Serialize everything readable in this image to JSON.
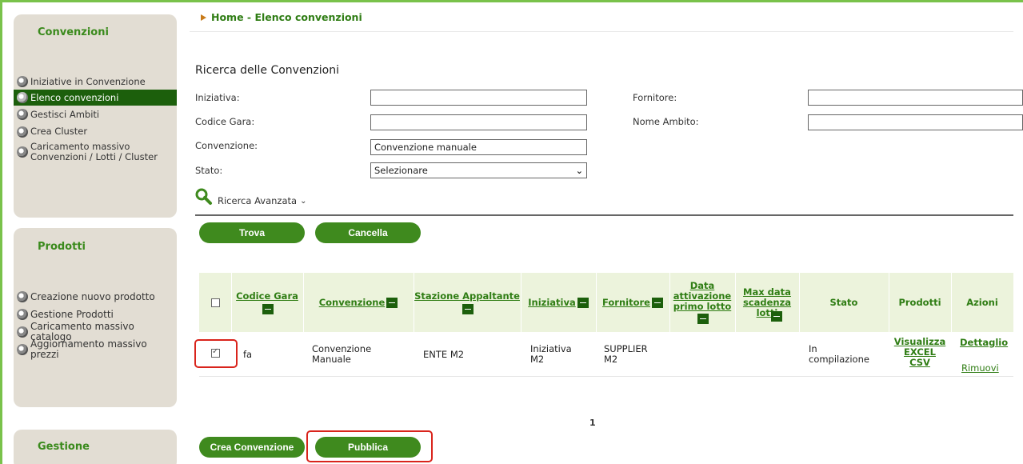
{
  "sidebar": {
    "convenzioni": {
      "title": "Convenzioni",
      "items": [
        {
          "label": "Iniziative in Convenzione"
        },
        {
          "label": "Elenco convenzioni"
        },
        {
          "label": "Gestisci Ambiti"
        },
        {
          "label": "Crea Cluster"
        },
        {
          "label": "Caricamento massivo\nConvenzioni / Lotti / Cluster"
        }
      ]
    },
    "prodotti": {
      "title": "Prodotti",
      "items": [
        {
          "label": "Creazione nuovo prodotto"
        },
        {
          "label": "Gestione Prodotti"
        },
        {
          "label": "Caricamento massivo catalogo"
        },
        {
          "label": "Aggiornamento massivo prezzi"
        }
      ]
    },
    "gestione": {
      "title": "Gestione"
    }
  },
  "breadcrumb": "Home - Elenco convenzioni",
  "search": {
    "title": "Ricerca delle Convenzioni",
    "iniziativa_label": "Iniziativa:",
    "iniziativa_value": "",
    "fornitore_label": "Fornitore:",
    "fornitore_value": "",
    "codice_gara_label": "Codice Gara:",
    "codice_gara_value": "",
    "nome_ambito_label": "Nome Ambito:",
    "nome_ambito_value": "",
    "convenzione_label": "Convenzione:",
    "convenzione_value": "Convenzione manuale",
    "stato_label": "Stato:",
    "stato_value": "Selezionare",
    "advanced_label": "Ricerca Avanzata",
    "find_button": "Trova",
    "clear_button": "Cancella"
  },
  "table": {
    "headers": {
      "codice_gara": "Codice Gara",
      "convenzione": "Convenzione",
      "stazione_appaltante": "Stazione Appaltante",
      "iniziativa": "Iniziativa",
      "fornitore": "Fornitore",
      "data_attivazione": "Data\nattivazione\nprimo lotto",
      "max_data_scadenza": "Max data\nscadenza\nlotti",
      "stato": "Stato",
      "prodotti": "Prodotti",
      "azioni": "Azioni"
    },
    "rows": [
      {
        "codice_gara": "fa",
        "convenzione": "Convenzione\nManuale",
        "stazione_appaltante": "ENTE M2",
        "iniziativa": "Iniziativa\nM2",
        "fornitore": "SUPPLIER\nM2",
        "data_attivazione": "",
        "max_data_scadenza": "",
        "stato": "In\ncompilazione",
        "prodotti_visualizza": "Visualizza",
        "prodotti_excel": "EXCEL",
        "prodotti_csv": "CSV",
        "azione_dettaglio": "Dettaglio",
        "azione_rimuovi": "Rimuovi",
        "selected": true
      }
    ],
    "page": "1"
  },
  "actions": {
    "crea_convenzione": "Crea Convenzione",
    "pubblica": "Pubblica"
  },
  "colors": {
    "accent_green": "#3f8a1e",
    "dark_green": "#1c5f0c",
    "highlight_red": "#d9241c",
    "sidebar_bg": "#e2ddd3",
    "header_bg": "#ecf3dc"
  }
}
